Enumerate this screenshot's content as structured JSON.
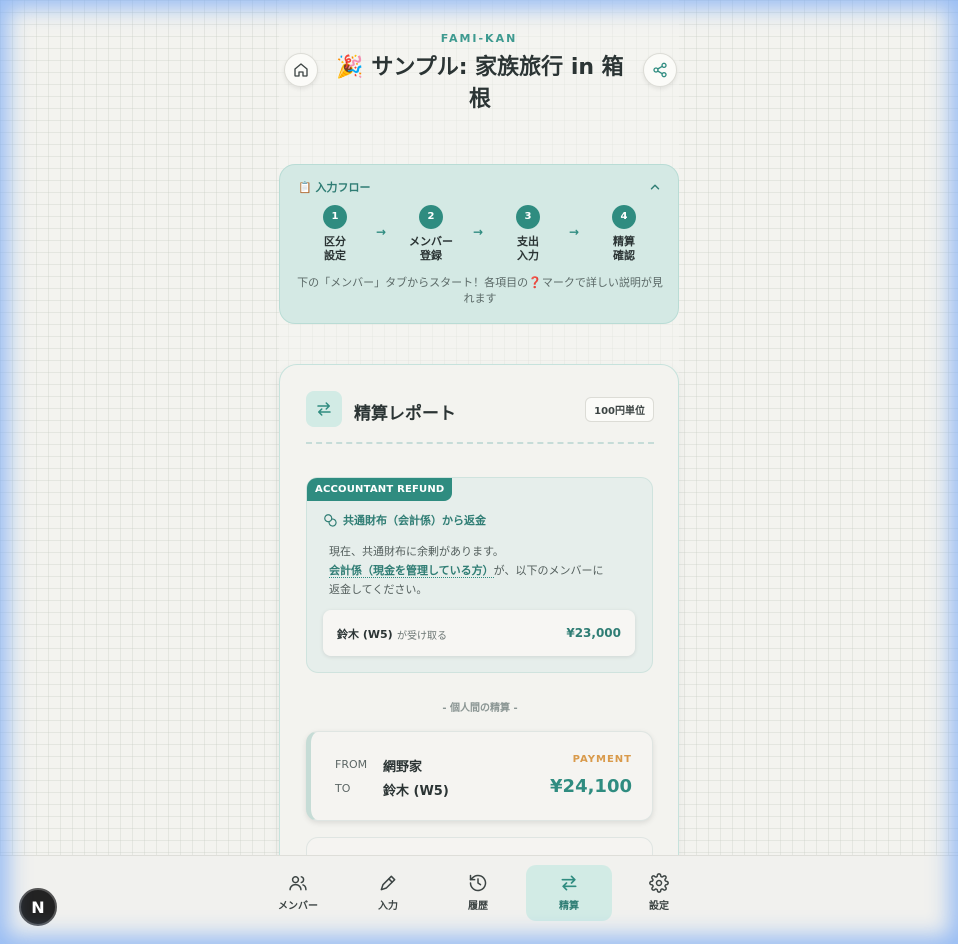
{
  "header": {
    "brand": "FAMI-KAN",
    "title": "🎉 サンプル: 家族旅行 in 箱根"
  },
  "flow": {
    "title": "📋 入力フロー",
    "steps": [
      {
        "num": "1",
        "label": "区分\n設定"
      },
      {
        "num": "2",
        "label": "メンバー\n登録"
      },
      {
        "num": "3",
        "label": "支出\n入力"
      },
      {
        "num": "4",
        "label": "精算\n確認"
      }
    ],
    "arrow": "→",
    "note": "下の「メンバー」タブからスタート！各項目の❓マークで詳しい説明が見れます"
  },
  "report": {
    "title": "精算レポート",
    "unit_badge": "100円単位",
    "refund": {
      "tag": "ACCOUNTANT REFUND",
      "heading": "共通財布（会計係）から返金",
      "line1": "現在、共通財布に余剰があります。",
      "accountant": "会計係（現金を管理している方）",
      "line2_suffix": "が、以下のメンバーに",
      "line3": "返金してください。",
      "recipient": "鈴木 (W5)",
      "receive_note": "が受け取る",
      "amount": "¥23,000"
    },
    "p2p_label": "- 個人間の精算 -",
    "payment": {
      "from_label": "FROM",
      "from": "網野家",
      "to_label": "TO",
      "to": "鈴木 (W5)",
      "tag": "PAYMENT",
      "amount": "¥24,100"
    }
  },
  "nav": {
    "items": [
      {
        "label": "メンバー",
        "icon": "users-icon"
      },
      {
        "label": "入力",
        "icon": "pen-icon"
      },
      {
        "label": "履歴",
        "icon": "history-icon"
      },
      {
        "label": "精算",
        "icon": "transfer-icon",
        "active": true
      },
      {
        "label": "設定",
        "icon": "gear-icon"
      }
    ]
  },
  "badge": {
    "letter": "N"
  },
  "colors": {
    "accent": "#2f8c80",
    "payment_tag": "#d99a4b",
    "flow_bg": "#d4e9e4"
  }
}
